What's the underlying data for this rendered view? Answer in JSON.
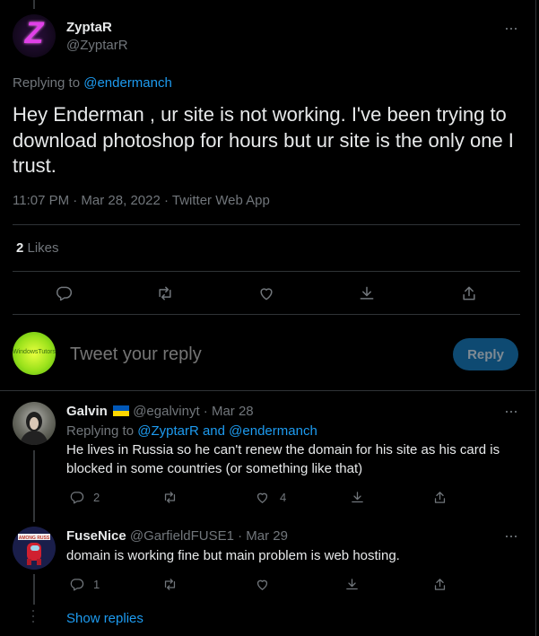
{
  "main_tweet": {
    "display_name": "ZyptaR",
    "handle": "@ZyptarR",
    "avatar_glyph": "Z",
    "replying_prefix": "Replying to",
    "replying_to": "@endermanch",
    "text": "Hey Enderman , ur site is not working. I've been trying to download photoshop for hours but ur site is the only one I trust.",
    "timestamp": "11:07 PM · Mar 28, 2022 · Twitter Web App",
    "likes_count": "2",
    "likes_label": " Likes",
    "more_glyph": "···"
  },
  "compose": {
    "placeholder": "Tweet your reply",
    "reply_button": "Reply",
    "avatar_text": "WindowsTutors"
  },
  "replies": [
    {
      "display_name": "Galvin",
      "flag": "Ukraine flag",
      "handle_time": "@egalvinyt · Mar 28",
      "replying_prefix": "Replying to",
      "replying_to_1": "@ZyptarR",
      "replying_and": "and",
      "replying_to_2": "@endermanch",
      "text": "He lives in Russia so he can't renew the domain for his site as his card is blocked in some countries (or something like that)",
      "reply_count": "2",
      "like_count": "4"
    },
    {
      "display_name": "FuseNice",
      "handle_time": "@GarfieldFUSE1 · Mar 29",
      "text": "domain is working fine but main problem is web hosting.",
      "reply_count": "1",
      "avatar_banner": "AMONG RUSS"
    }
  ],
  "show_replies": "Show replies",
  "icons": [
    "reply-icon",
    "retweet-icon",
    "like-icon",
    "download-icon",
    "share-icon",
    "more-icon"
  ],
  "colors": {
    "background": "#000000",
    "accent": "#1d9bf0",
    "muted": "#71767b",
    "text": "#e7e9ea"
  }
}
